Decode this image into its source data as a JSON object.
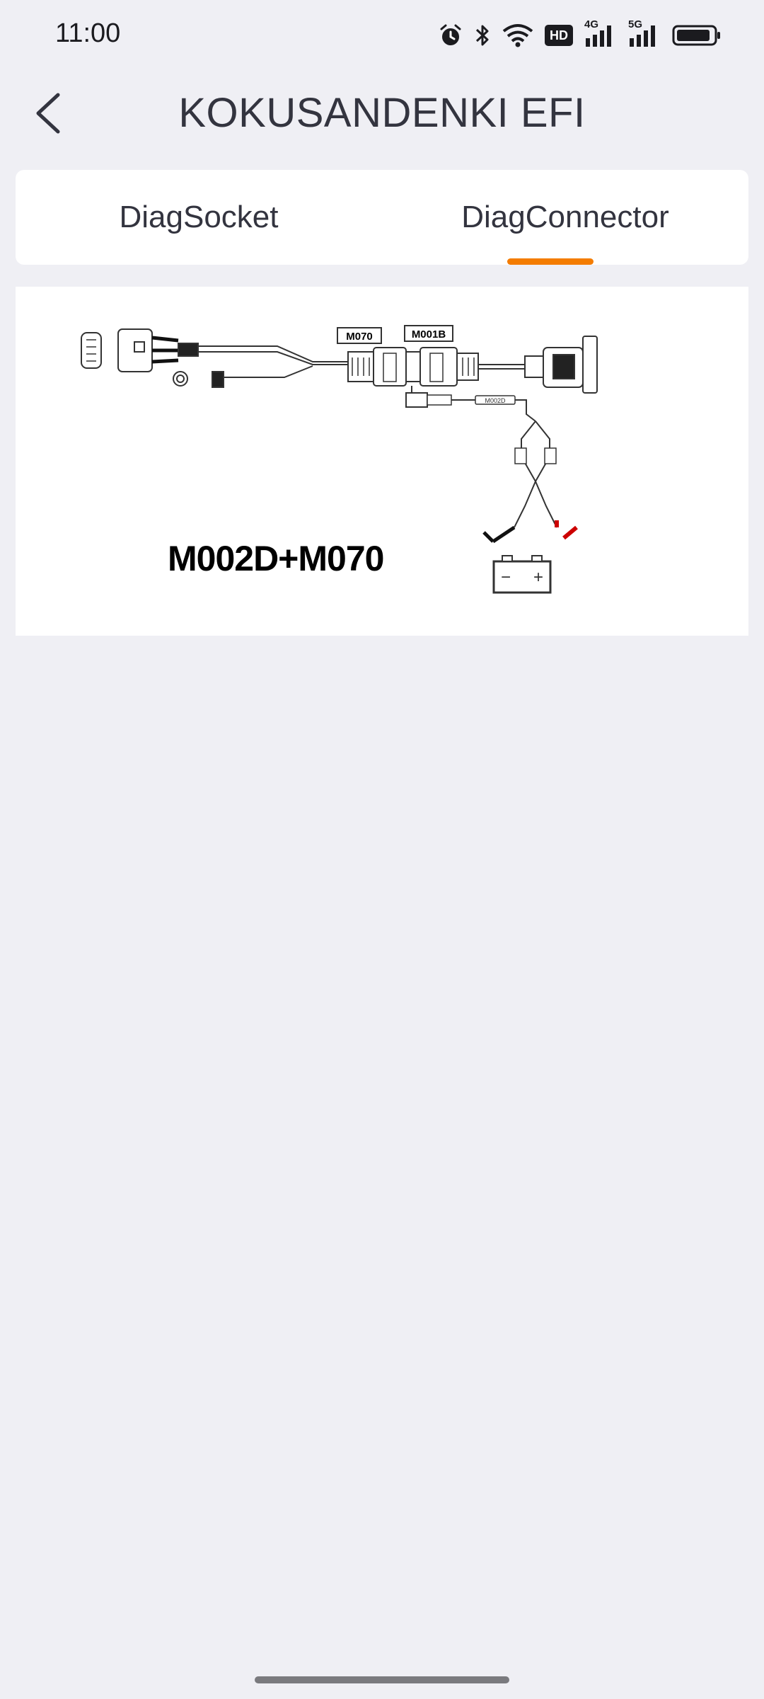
{
  "status_bar": {
    "time": "11:00",
    "icons": [
      "alarm-icon",
      "bluetooth-icon",
      "wifi-icon",
      "hd-icon",
      "signal-4g-icon",
      "signal-5g-icon",
      "battery-icon"
    ],
    "hd_label": "HD",
    "network_4g": "4G",
    "network_5g": "5G"
  },
  "header": {
    "title": "KOKUSANDENKI EFI",
    "back_icon": "chevron-left-icon"
  },
  "tabs": [
    {
      "label": "DiagSocket",
      "active": false
    },
    {
      "label": "DiagConnector",
      "active": true
    }
  ],
  "accent_color": "#f47c00",
  "diagram": {
    "caption": "M002D+M070",
    "labels": {
      "m070": "M070",
      "m001b": "M001B",
      "m002d": "M002D",
      "minus": "−",
      "plus": "+"
    }
  }
}
